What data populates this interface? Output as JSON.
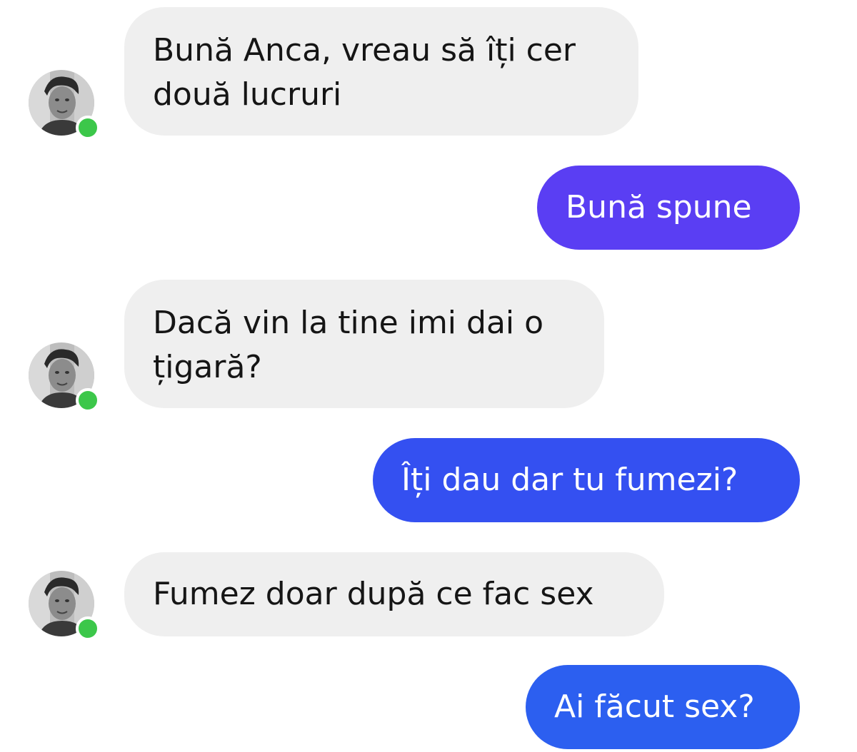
{
  "colors": {
    "incoming_bubble": "#efefef",
    "outgoing_gradient": [
      "#5c3cf2",
      "#4a3df4",
      "#2f55f0",
      "#2a62ee"
    ],
    "online_dot": "#3cc74a"
  },
  "messages": [
    {
      "direction": "incoming",
      "lines": [
        "Bună Anca, vreau să îți cer",
        "două lucruri"
      ],
      "avatar": "avatar-icon",
      "online": true
    },
    {
      "direction": "outgoing",
      "text": "Bună spune"
    },
    {
      "direction": "incoming",
      "lines": [
        "Dacă vin la tine imi dai o",
        "țigară?"
      ],
      "avatar": "avatar-icon",
      "online": true
    },
    {
      "direction": "outgoing",
      "text": "Îți dau dar tu fumezi?"
    },
    {
      "direction": "incoming",
      "lines": [
        "Fumez doar după ce fac sex"
      ],
      "avatar": "avatar-icon",
      "online": true
    },
    {
      "direction": "outgoing",
      "text": "Ai făcut sex?"
    }
  ]
}
